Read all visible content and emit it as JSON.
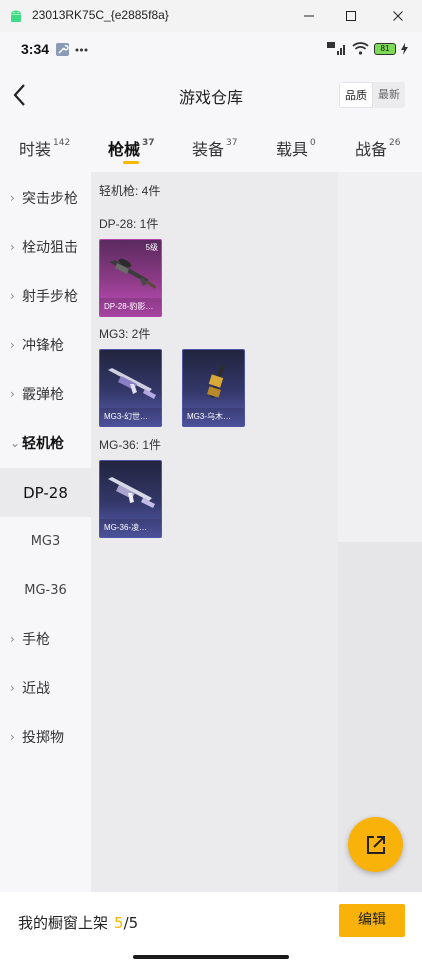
{
  "window": {
    "title": "23013RK75C_{e2885f8a}",
    "icon": "android-icon",
    "buttons": [
      "minimize-icon",
      "maximize-icon",
      "close-icon"
    ]
  },
  "status_bar": {
    "time": "3:34",
    "battery": "81",
    "icons": [
      "wrench-icon",
      "more-dots-icon",
      "hd-signal-icon",
      "wifi-icon",
      "battery-icon",
      "charging-icon"
    ]
  },
  "header": {
    "title": "游戏仓库",
    "sort_options": [
      "品质",
      "最新"
    ],
    "sort_selected": "品质"
  },
  "tabs": [
    {
      "label": "时装",
      "count": "142"
    },
    {
      "label": "枪械",
      "count": "37"
    },
    {
      "label": "装备",
      "count": "37"
    },
    {
      "label": "载具",
      "count": "0"
    },
    {
      "label": "战备",
      "count": "26"
    }
  ],
  "tabs_active": "枪械",
  "sidebar": {
    "items": [
      {
        "label": "突击步枪"
      },
      {
        "label": "栓动狙击"
      },
      {
        "label": "射手步枪"
      },
      {
        "label": "冲锋枪"
      },
      {
        "label": "霰弹枪"
      },
      {
        "label": "轻机枪"
      },
      {
        "label": "手枪"
      },
      {
        "label": "近战"
      },
      {
        "label": "投掷物"
      }
    ],
    "subitems": [
      {
        "label": "DP-28"
      },
      {
        "label": "MG3"
      },
      {
        "label": "MG-36"
      }
    ],
    "expanded": "轻机枪",
    "selected": "DP-28"
  },
  "content": {
    "total": "轻机枪: 4件",
    "groups": [
      {
        "heading": "DP-28: 1件",
        "items": [
          {
            "name": "DP-28-豹影…",
            "level": "5级",
            "rarity": "pink"
          }
        ]
      },
      {
        "heading": "MG3: 2件",
        "items": [
          {
            "name": "MG3-幻世…",
            "rarity": "blue"
          },
          {
            "name": "MG3-乌木…",
            "rarity": "blue"
          }
        ]
      },
      {
        "heading": "MG-36: 1件",
        "items": [
          {
            "name": "MG-36-凌…",
            "rarity": "blue"
          }
        ]
      }
    ]
  },
  "fab": {
    "icon": "share-icon"
  },
  "bottom": {
    "label": "我的橱窗上架",
    "current": "5",
    "total": "/5",
    "edit": "编辑"
  },
  "colors": {
    "accent": "#f8b20a",
    "pink_card": "#c24fbd",
    "blue_card": "#5a5fb4"
  }
}
